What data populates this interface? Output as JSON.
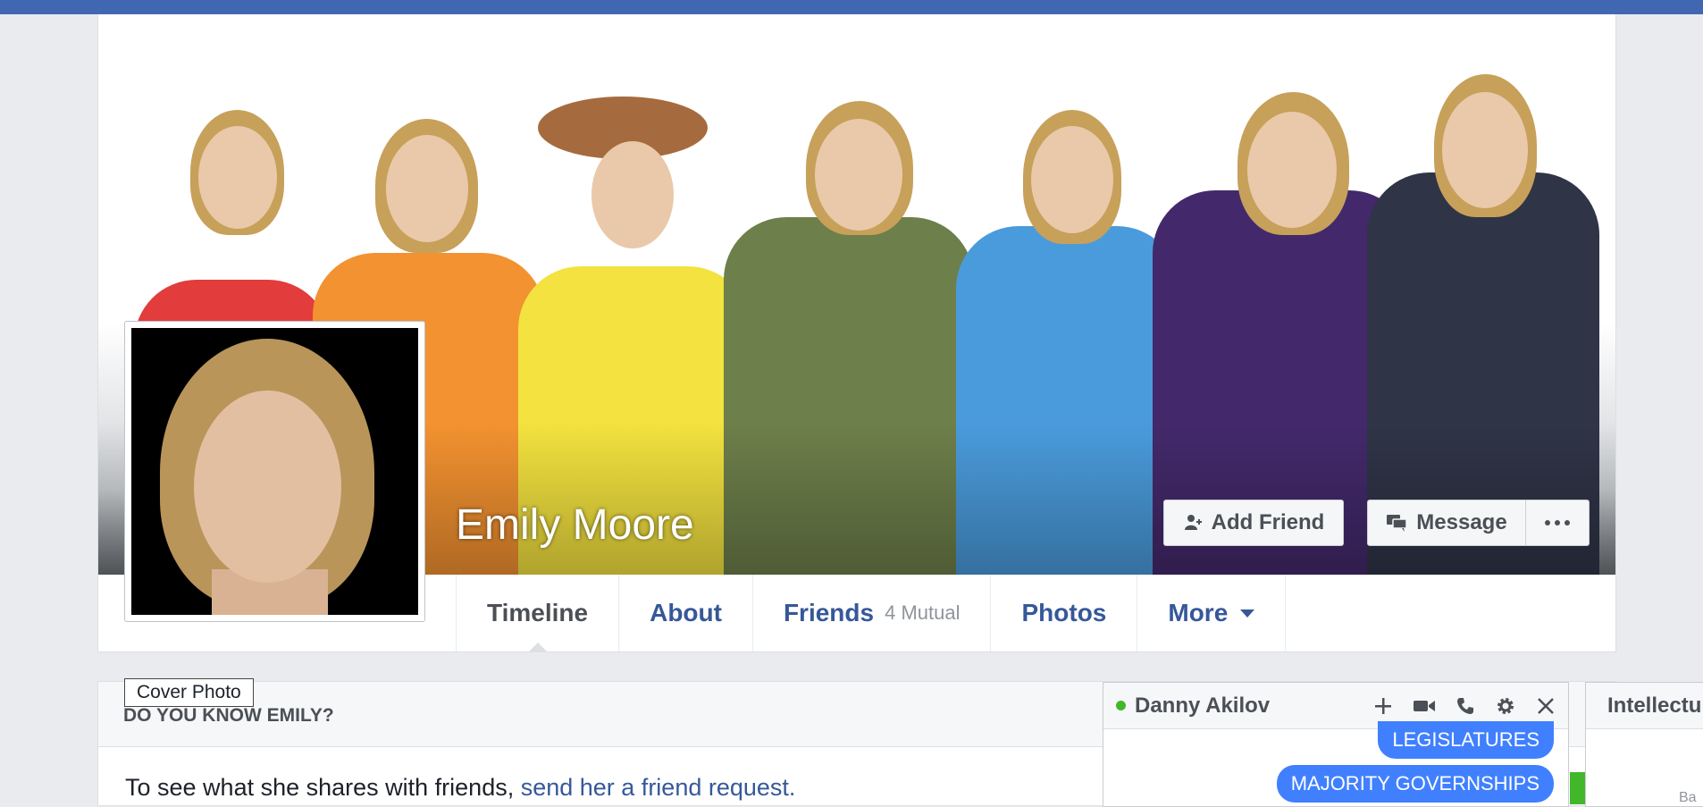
{
  "profile": {
    "name": "Emily Moore",
    "actions": {
      "add_friend": "Add Friend",
      "message": "Message"
    },
    "cover_tooltip": "Cover Photo"
  },
  "tabs": [
    {
      "label": "Timeline"
    },
    {
      "label": "About"
    },
    {
      "label": "Friends",
      "sub": "4 Mutual"
    },
    {
      "label": "Photos"
    },
    {
      "label": "More"
    }
  ],
  "know_card": {
    "title": "DO YOU KNOW EMILY?",
    "text_prefix": "To see what she shares with friends, ",
    "link_text": "send her a friend request."
  },
  "chat": {
    "name": "Danny Akilov",
    "messages": [
      "LEGISLATURES",
      "MAJORITY GOVERNSHIPS"
    ]
  },
  "chat2": {
    "name": "Intellectu",
    "footer": "Ba"
  },
  "colors": {
    "brand": "#4267b2",
    "link": "#365899",
    "online": "#42b72a",
    "bubble": "#4080ff"
  },
  "icons": [
    "add-person-icon",
    "message-icon",
    "more-dots-icon",
    "caret-down-icon",
    "plus-icon",
    "video-icon",
    "phone-icon",
    "gear-icon",
    "close-icon"
  ]
}
